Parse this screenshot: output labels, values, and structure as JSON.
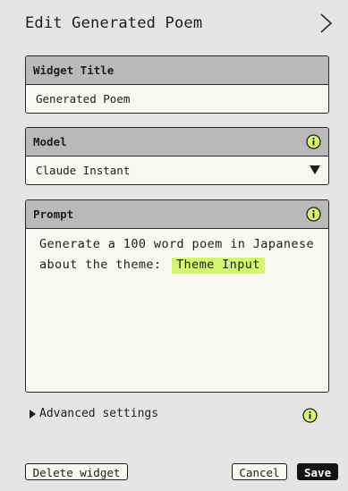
{
  "header": {
    "title": "Edit Generated Poem",
    "close_icon": "chevron-right-icon"
  },
  "widget_title": {
    "label": "Widget Title",
    "value": "Generated Poem"
  },
  "model": {
    "label": "Model",
    "selected": "Claude Instant",
    "info_icon": "info-icon"
  },
  "prompt": {
    "label": "Prompt",
    "text": "Generate a 100 word poem in Japanese about the theme:",
    "variable": "Theme Input",
    "info_icon": "info-icon"
  },
  "advanced": {
    "label": "Advanced settings"
  },
  "footer": {
    "delete_label": "Delete widget",
    "cancel_label": "Cancel",
    "save_label": "Save"
  },
  "colors": {
    "background": "#e5e5e3",
    "panel_header": "#b9b9b9",
    "panel_body": "#f8f7f1",
    "info_badge": "#d5f571",
    "variable_highlight": "#d5f571",
    "primary_button": "#141414"
  }
}
